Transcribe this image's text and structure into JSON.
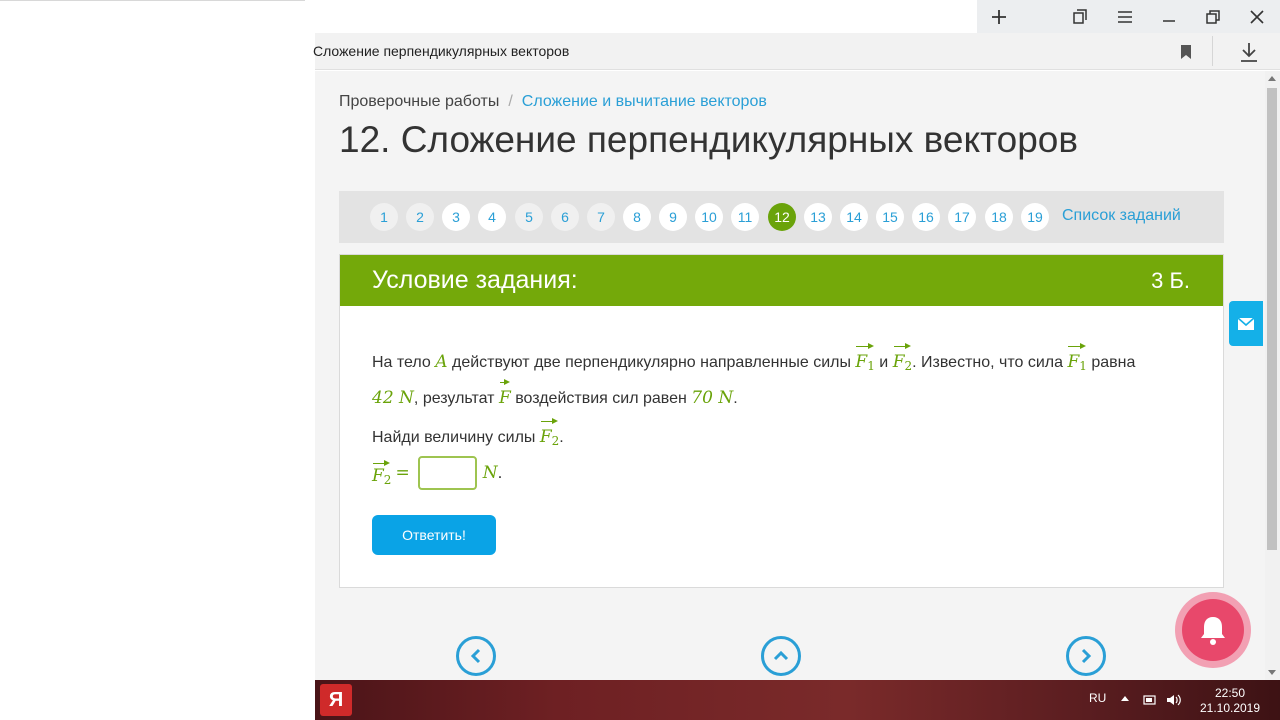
{
  "browser": {
    "tab_title": "Сложение перпендикулярных векторов",
    "buttons": [
      "new-tab",
      "pin",
      "menu",
      "minimize",
      "restore",
      "close"
    ]
  },
  "page": {
    "breadcrumb": {
      "root": "Проверочные работы",
      "separator": "/",
      "current": "Сложение и вычитание векторов"
    },
    "title": "12. Сложение перпендикулярных векторов",
    "pagination": {
      "pages": [
        "1",
        "2",
        "3",
        "4",
        "5",
        "6",
        "7",
        "8",
        "9",
        "10",
        "11",
        "12",
        "13",
        "14",
        "15",
        "16",
        "17",
        "18",
        "19"
      ],
      "current": "12",
      "list_link": "Список заданий"
    },
    "task": {
      "header": "Условие задания:",
      "points": "3 Б.",
      "text": {
        "t1": "На тело ",
        "body": "A",
        "t2": " действуют две перпендикулярно направленные силы ",
        "f1": "F",
        "f1_sub": "1",
        "t3": " и ",
        "f2": "F",
        "f2_sub": "2",
        "t4": ". Известно, что сила ",
        "t5": " равна",
        "val1": "42 N",
        "t6": ", результат ",
        "f": "F",
        "t7": " воздействия сил равен ",
        "val2": "70 N",
        "t8": ".",
        "question": "Найди величину силы ",
        "t9": "."
      },
      "answer": {
        "eq": "=",
        "unit": "N",
        "period": ".",
        "value": ""
      },
      "submit_label": "Ответить!"
    }
  },
  "taskbar": {
    "start_label": "Я",
    "lang": "RU",
    "time": "22:50",
    "date": "21.10.2019"
  },
  "colors": {
    "accent_green": "#74a90a",
    "link_blue": "#2a9fd6",
    "button_blue": "#0aa3e6",
    "bell_pink": "#e8486b"
  }
}
